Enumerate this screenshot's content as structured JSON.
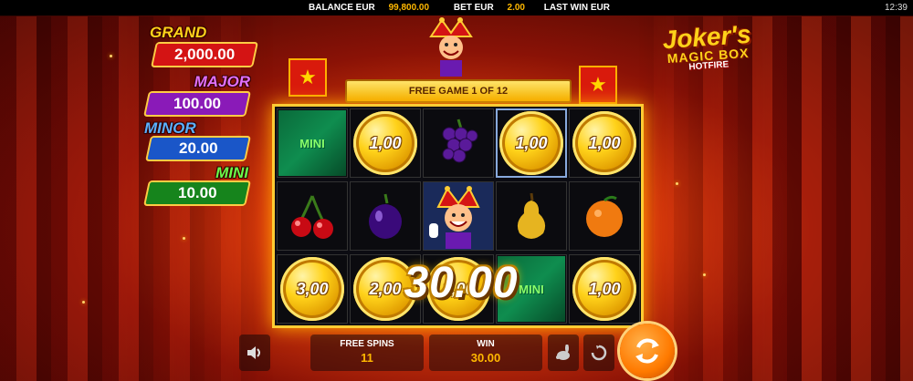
{
  "topbar": {
    "balance_label": "BALANCE EUR",
    "balance_value": "99,800.00",
    "bet_label": "BET EUR",
    "bet_value": "2.00",
    "lastwin_label": "LAST WIN EUR",
    "clock": "12:39"
  },
  "jackpots": {
    "grand": {
      "label": "GRAND",
      "value": "2,000.00",
      "color": "#d41414"
    },
    "major": {
      "label": "MAJOR",
      "value": "100.00",
      "color": "#8a1ab8"
    },
    "minor": {
      "label": "MINOR",
      "value": "20.00",
      "color": "#1a56c8"
    },
    "mini": {
      "label": "MINI",
      "value": "10.00",
      "color": "#16841c"
    }
  },
  "logo": {
    "line1": "Joker's",
    "line2": "MAGIC BOX",
    "line3": "HOTFIRE"
  },
  "ribbon": "FREE GAME 1 OF 12",
  "reels": {
    "mini_label": "MINI",
    "coin_1": "1,00",
    "coin_2": "1,00",
    "coin_3": "1,00",
    "coin_4": "3,00",
    "coin_5": "2,00",
    "coin_6": "1,00",
    "coin_7": "1,00"
  },
  "win_display": "30.00",
  "bottom": {
    "free_spins_label": "FREE SPINS",
    "free_spins_value": "11",
    "win_label": "WIN",
    "win_value": "30.00"
  },
  "icons": [
    "sound-icon",
    "turbo-rabbit-icon",
    "autoplay-icon",
    "spin-icon"
  ]
}
